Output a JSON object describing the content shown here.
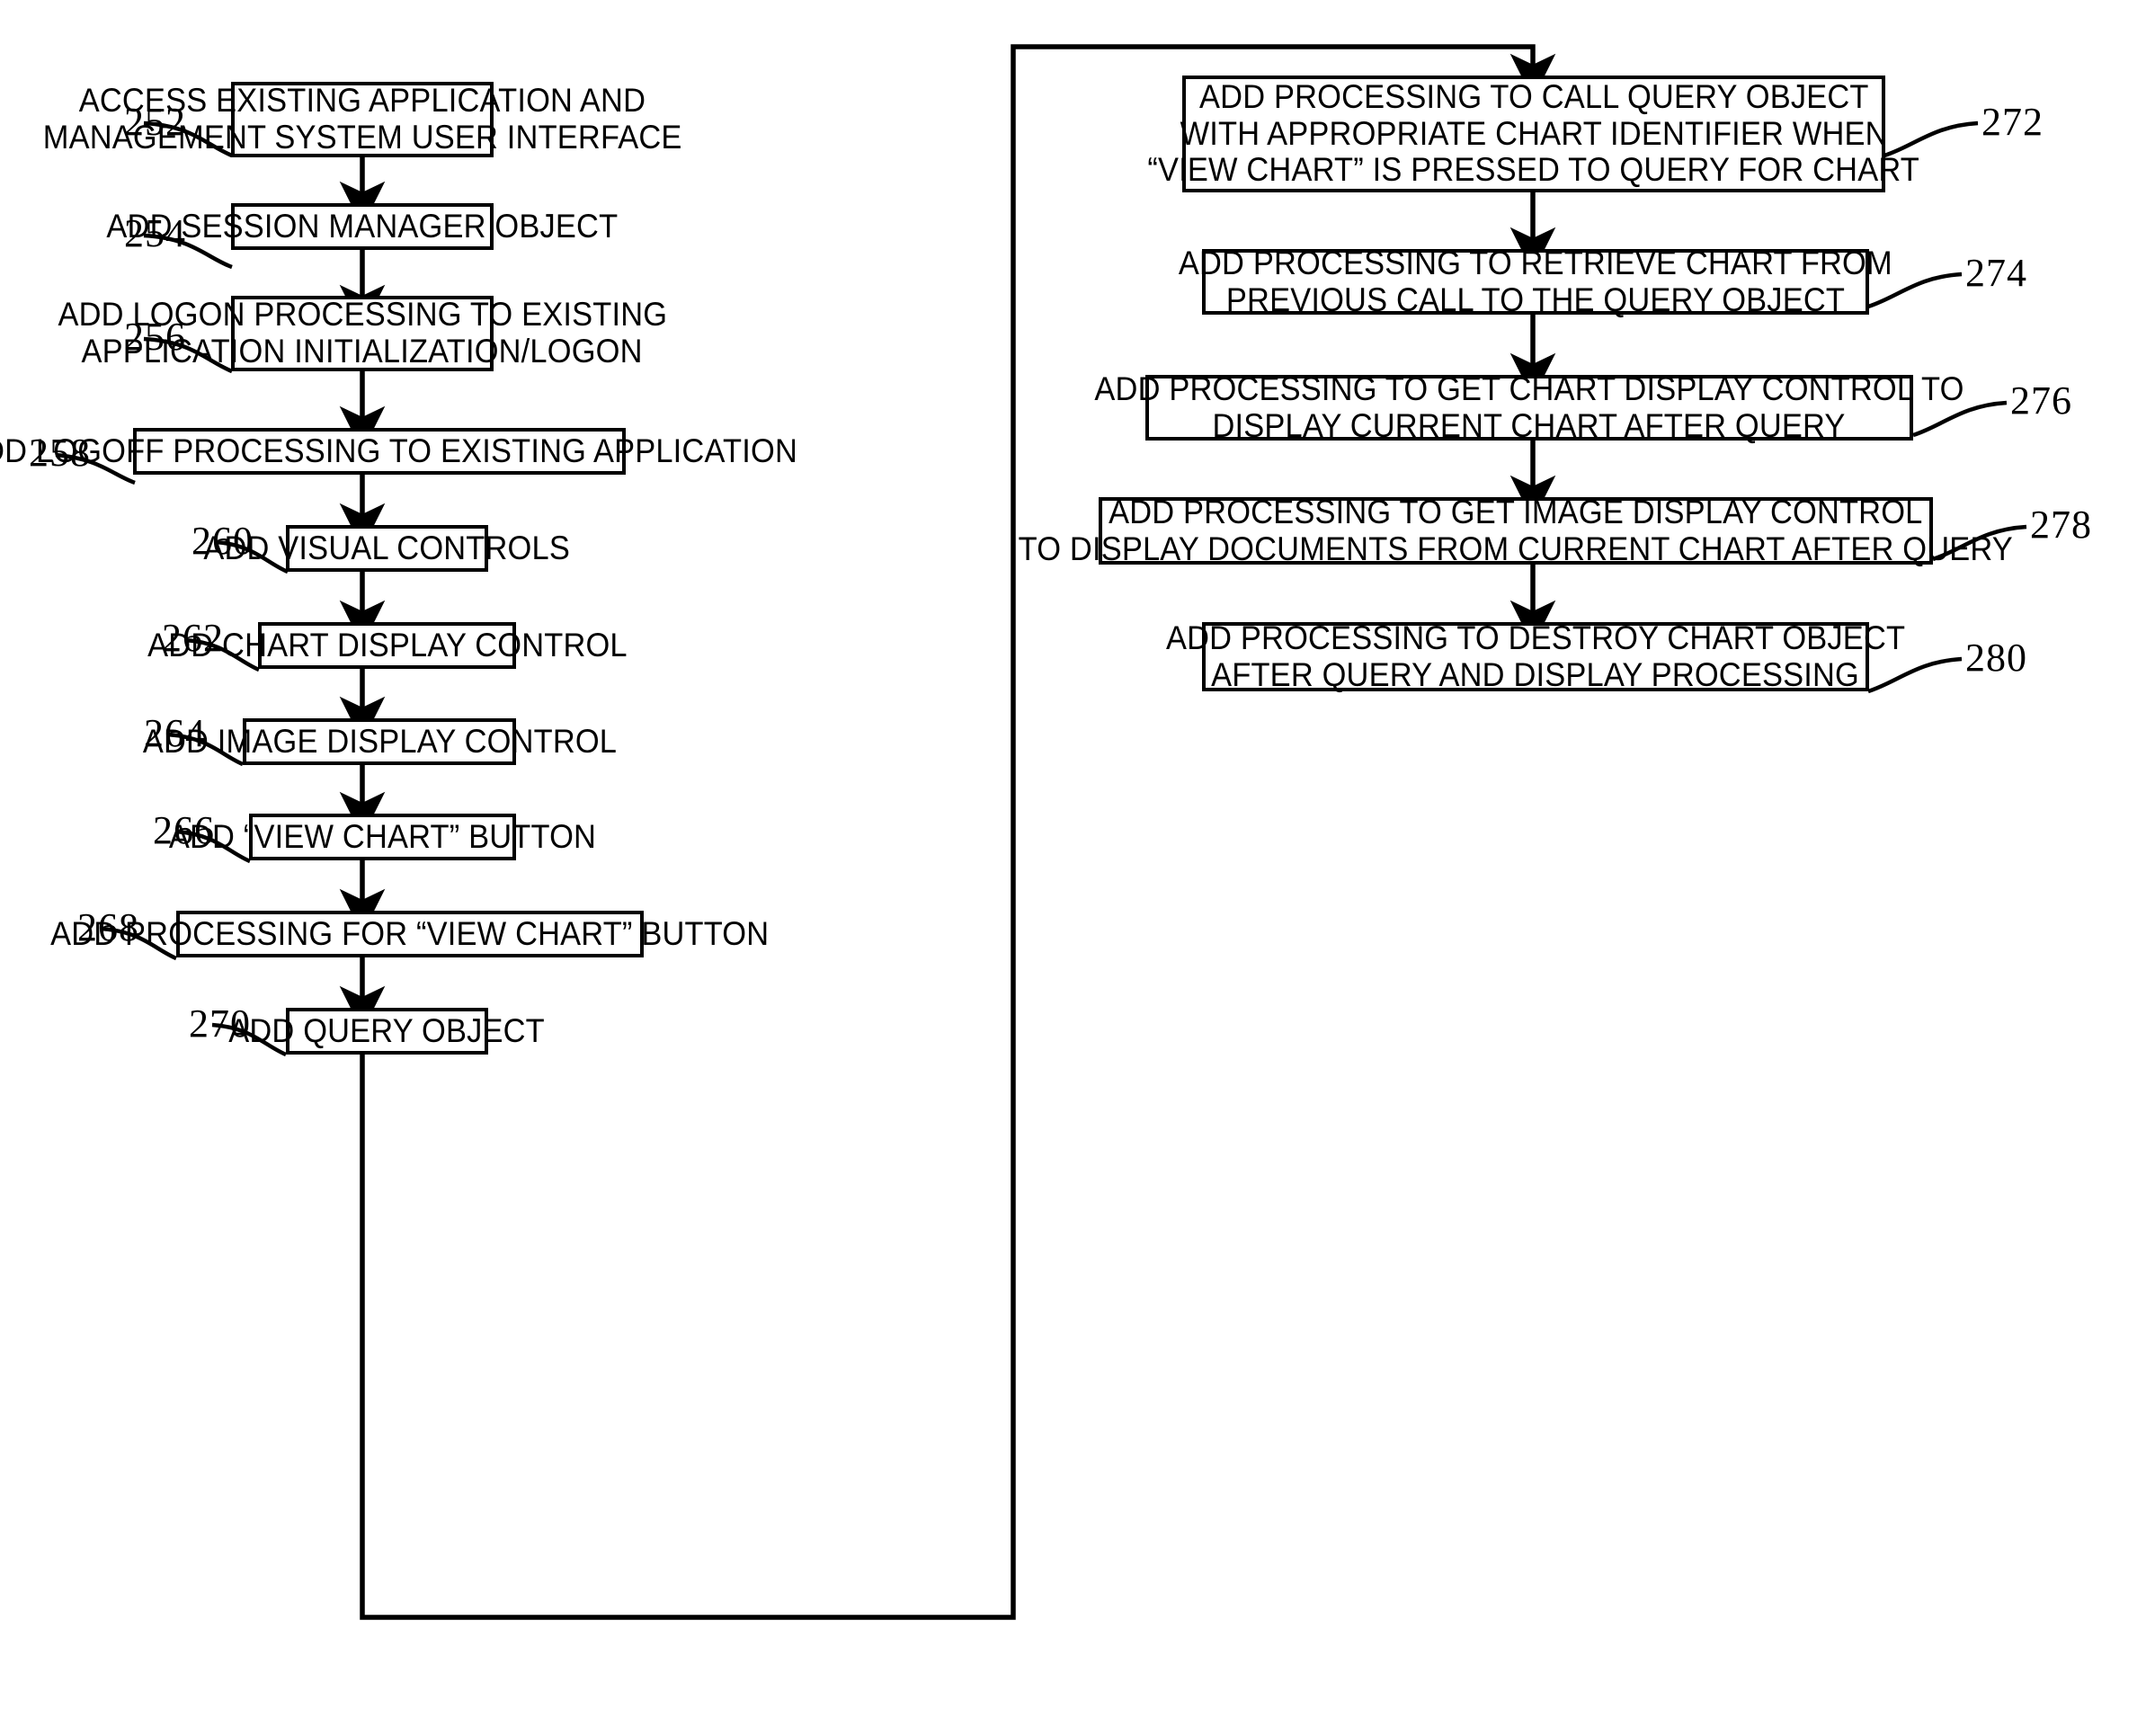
{
  "figure": {
    "type": "patent-flowchart",
    "orientation": "two-column",
    "stroke_color": "#000000",
    "background_color": "#ffffff"
  },
  "nodes": [
    {
      "ref": "252",
      "lines": [
        "ACCESS EXISTING APPLICATION AND",
        "MANAGEMENT SYSTEM USER INTERFACE"
      ],
      "column": "left"
    },
    {
      "ref": "254",
      "lines": [
        "ADD SESSION MANAGER OBJECT"
      ],
      "column": "left"
    },
    {
      "ref": "256",
      "lines": [
        "ADD LOGON PROCESSING TO EXISTING",
        "APPLICATION INITIALIZATION/LOGON"
      ],
      "column": "left"
    },
    {
      "ref": "258",
      "lines": [
        "ADD LOGOFF PROCESSING TO EXISTING APPLICATION"
      ],
      "column": "left"
    },
    {
      "ref": "260",
      "lines": [
        "ADD VISUAL CONTROLS"
      ],
      "column": "left"
    },
    {
      "ref": "262",
      "lines": [
        "ADD CHART DISPLAY CONTROL"
      ],
      "column": "left"
    },
    {
      "ref": "264",
      "lines": [
        "ADD IMAGE DISPLAY CONTROL"
      ],
      "column": "left"
    },
    {
      "ref": "266",
      "lines": [
        "ADD “VIEW CHART” BUTTON"
      ],
      "column": "left"
    },
    {
      "ref": "268",
      "lines": [
        "ADD PROCESSING FOR “VIEW CHART” BUTTON"
      ],
      "column": "left"
    },
    {
      "ref": "270",
      "lines": [
        "ADD QUERY OBJECT"
      ],
      "column": "left"
    },
    {
      "ref": "272",
      "lines": [
        "ADD PROCESSING TO CALL QUERY OBJECT",
        "WITH APPROPRIATE CHART IDENTIFIER WHEN",
        "“VIEW CHART” IS PRESSED TO QUERY FOR CHART"
      ],
      "column": "right"
    },
    {
      "ref": "274",
      "lines": [
        "ADD PROCESSING TO RETRIEVE CHART FROM",
        "PREVIOUS CALL TO THE QUERY OBJECT"
      ],
      "column": "right"
    },
    {
      "ref": "276",
      "lines": [
        "ADD PROCESSING TO GET CHART DISPLAY CONTROL TO",
        "DISPLAY CURRENT CHART AFTER QUERY"
      ],
      "column": "right"
    },
    {
      "ref": "278",
      "lines": [
        "ADD PROCESSING TO GET IMAGE DISPLAY CONTROL",
        "TO DISPLAY DOCUMENTS FROM CURRENT CHART AFTER QUERY"
      ],
      "column": "right"
    },
    {
      "ref": "280",
      "lines": [
        "ADD PROCESSING TO DESTROY CHART OBJECT",
        "AFTER QUERY AND DISPLAY PROCESSING"
      ],
      "column": "right"
    }
  ],
  "connectors": [
    {
      "from": "252",
      "to": "254",
      "kind": "arrow-down"
    },
    {
      "from": "254",
      "to": "256",
      "kind": "arrow-down"
    },
    {
      "from": "256",
      "to": "258",
      "kind": "arrow-down"
    },
    {
      "from": "258",
      "to": "260",
      "kind": "arrow-down"
    },
    {
      "from": "260",
      "to": "262",
      "kind": "arrow-down"
    },
    {
      "from": "262",
      "to": "264",
      "kind": "arrow-down"
    },
    {
      "from": "264",
      "to": "266",
      "kind": "arrow-down"
    },
    {
      "from": "266",
      "to": "268",
      "kind": "arrow-down"
    },
    {
      "from": "268",
      "to": "270",
      "kind": "arrow-down"
    },
    {
      "from": "270",
      "to": "272",
      "kind": "routed-loop"
    },
    {
      "from": "272",
      "to": "274",
      "kind": "arrow-down"
    },
    {
      "from": "274",
      "to": "276",
      "kind": "arrow-down"
    },
    {
      "from": "276",
      "to": "278",
      "kind": "arrow-down"
    },
    {
      "from": "278",
      "to": "280",
      "kind": "arrow-down"
    }
  ]
}
